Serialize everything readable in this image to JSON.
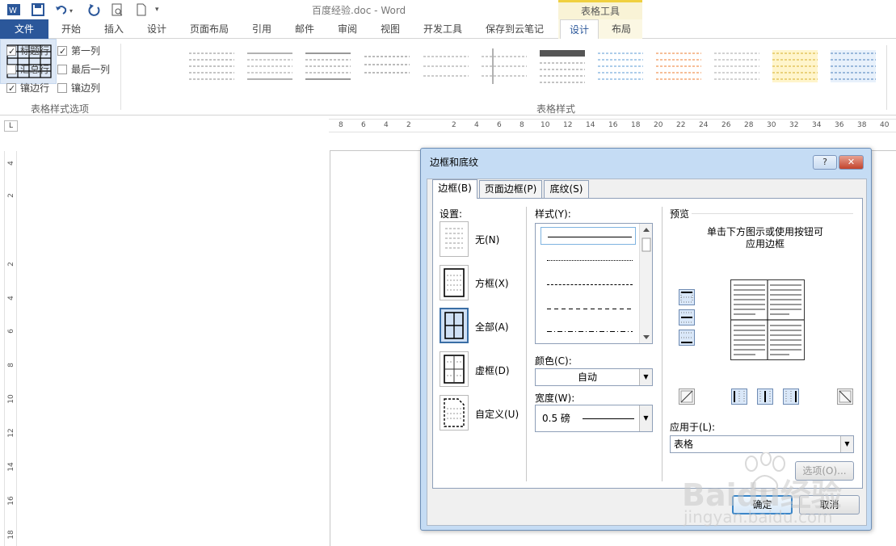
{
  "window": {
    "title": "百度经验.doc - Word",
    "tools_group": "表格工具",
    "qat": [
      "word-icon",
      "save-icon",
      "undo-icon",
      "redo-icon",
      "print-preview-icon",
      "new-doc-icon",
      "qat-customize-icon"
    ]
  },
  "tabs": [
    {
      "label": "文件"
    },
    {
      "label": "开始"
    },
    {
      "label": "插入"
    },
    {
      "label": "设计"
    },
    {
      "label": "页面布局"
    },
    {
      "label": "引用"
    },
    {
      "label": "邮件"
    },
    {
      "label": "审阅"
    },
    {
      "label": "视图"
    },
    {
      "label": "开发工具"
    },
    {
      "label": "保存到云笔记"
    },
    {
      "label": "设计"
    },
    {
      "label": "布局"
    }
  ],
  "ribbon": {
    "options": [
      {
        "label": "标题行",
        "checked": true
      },
      {
        "label": "第一列",
        "checked": true
      },
      {
        "label": "汇总行",
        "checked": false
      },
      {
        "label": "最后一列",
        "checked": false
      },
      {
        "label": "镶边行",
        "checked": true
      },
      {
        "label": "镶边列",
        "checked": false
      }
    ],
    "group_options": "表格样式选项",
    "group_styles": "表格样式"
  },
  "ruler": {
    "corner": "L",
    "ticks": [
      "8",
      "6",
      "4",
      "2",
      "2",
      "4",
      "6",
      "8",
      "10",
      "12",
      "14",
      "16",
      "18",
      "20",
      "22",
      "24",
      "26",
      "28",
      "30",
      "32",
      "34",
      "36",
      "38",
      "40"
    ],
    "vticks": [
      "4",
      "2",
      "2",
      "4",
      "6",
      "8",
      "10",
      "12",
      "14",
      "16",
      "18"
    ]
  },
  "dialog": {
    "title": "边框和底纹",
    "help": "?",
    "close": "✕",
    "tabs": [
      {
        "label": "边框(B)"
      },
      {
        "label": "页面边框(P)"
      },
      {
        "label": "底纹(S)"
      }
    ],
    "settings_label": "设置:",
    "settings": [
      {
        "label": "无(N)"
      },
      {
        "label": "方框(X)"
      },
      {
        "label": "全部(A)"
      },
      {
        "label": "虚框(D)"
      },
      {
        "label": "自定义(U)"
      }
    ],
    "style_label": "样式(Y):",
    "color_label": "颜色(C):",
    "color_value": "自动",
    "width_label": "宽度(W):",
    "width_value": "0.5 磅",
    "preview_label": "预览",
    "preview_hint_1": "单击下方图示或使用按钮可",
    "preview_hint_2": "应用边框",
    "apply_label": "应用于(L):",
    "apply_value": "表格",
    "options_button": "选项(O)...",
    "ok_button": "确定",
    "cancel_button": "取消"
  },
  "watermark": {
    "brand": "Baidu经验",
    "url": "jingyan.baidu.com"
  }
}
